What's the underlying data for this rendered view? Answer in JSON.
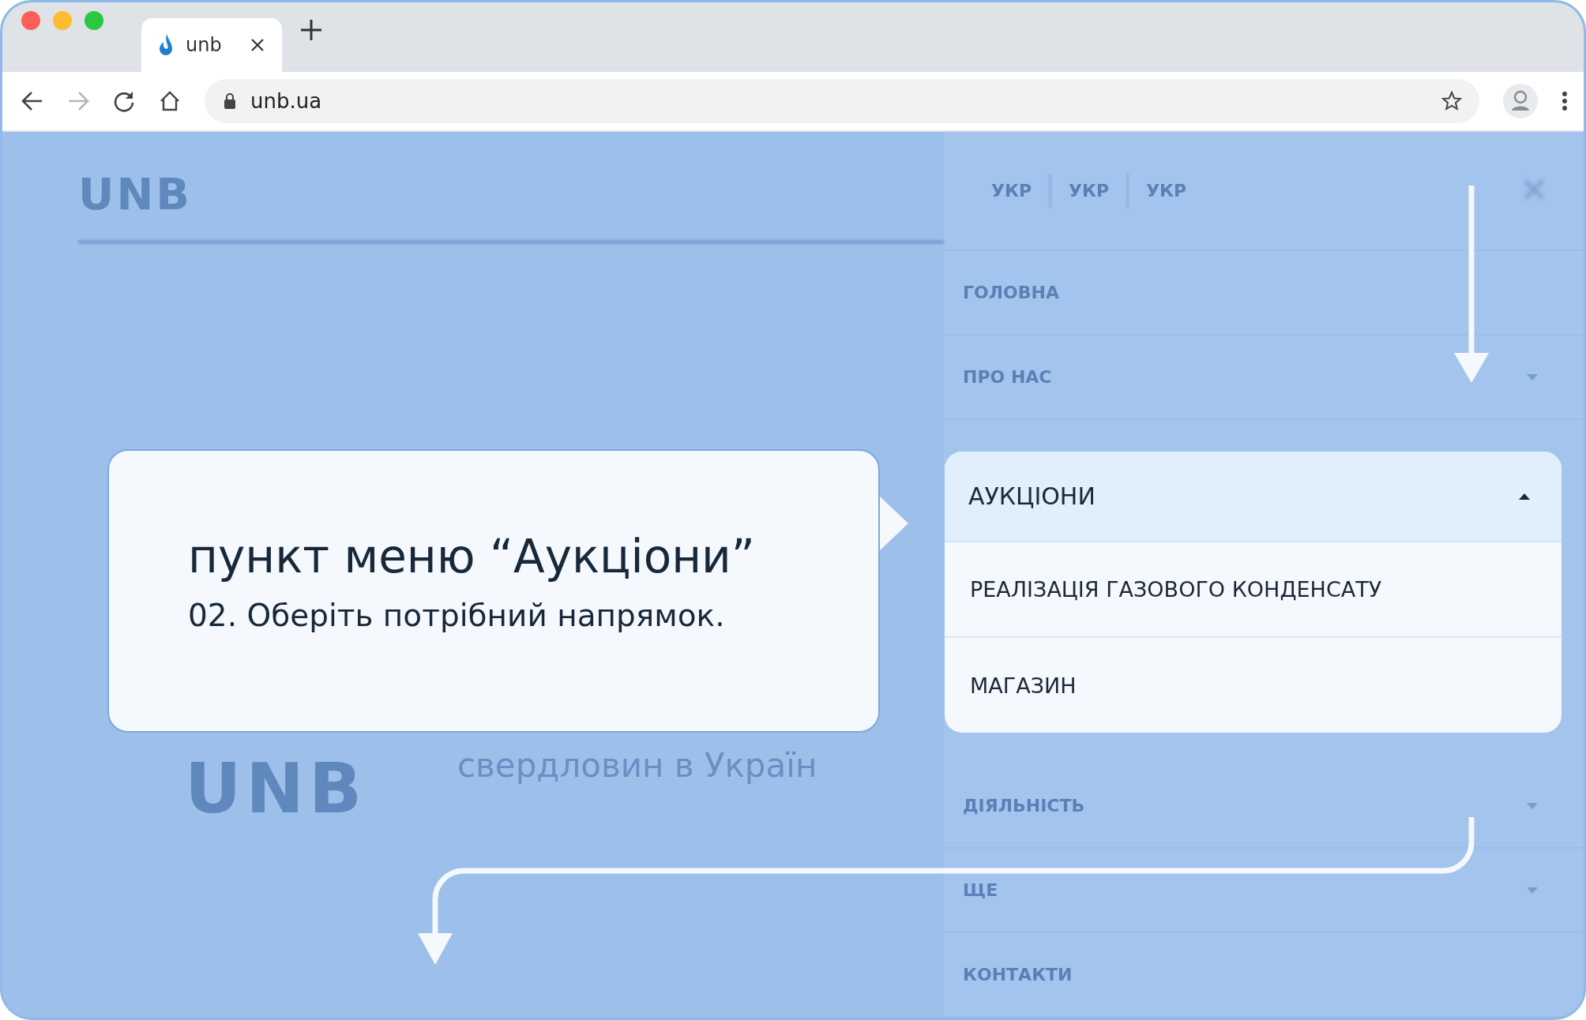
{
  "browser": {
    "tabs": [
      {
        "title": "unb",
        "selected": true
      }
    ],
    "address": "unb.ua",
    "forward_disabled": true
  },
  "page": {
    "logo": "UNB",
    "subtitle": "свердловин в Україн",
    "logo_big": "UNB"
  },
  "drawer": {
    "languages": [
      "УКР",
      "УКР",
      "УКР"
    ],
    "items_before": [
      {
        "label": "ГОЛОВНА",
        "has_submenu": false
      },
      {
        "label": "ПРО НАС",
        "has_submenu": true
      }
    ],
    "items_after": [
      {
        "label": "ДІЯЛЬНІСТЬ",
        "has_submenu": true
      },
      {
        "label": "ЩЕ",
        "has_submenu": true
      },
      {
        "label": "КОНТАКТИ",
        "has_submenu": false
      }
    ]
  },
  "menu": {
    "title": "АУКЦІОНИ",
    "expanded": true,
    "items": [
      "РЕАЛІЗАЦІЯ ГАЗОВОГО КОНДЕНСАТУ",
      "МАГАЗИН"
    ]
  },
  "callout": {
    "title": "пункт меню “Аукціони”",
    "step": "02.",
    "text": "Оберіть потрібний напрямок."
  }
}
